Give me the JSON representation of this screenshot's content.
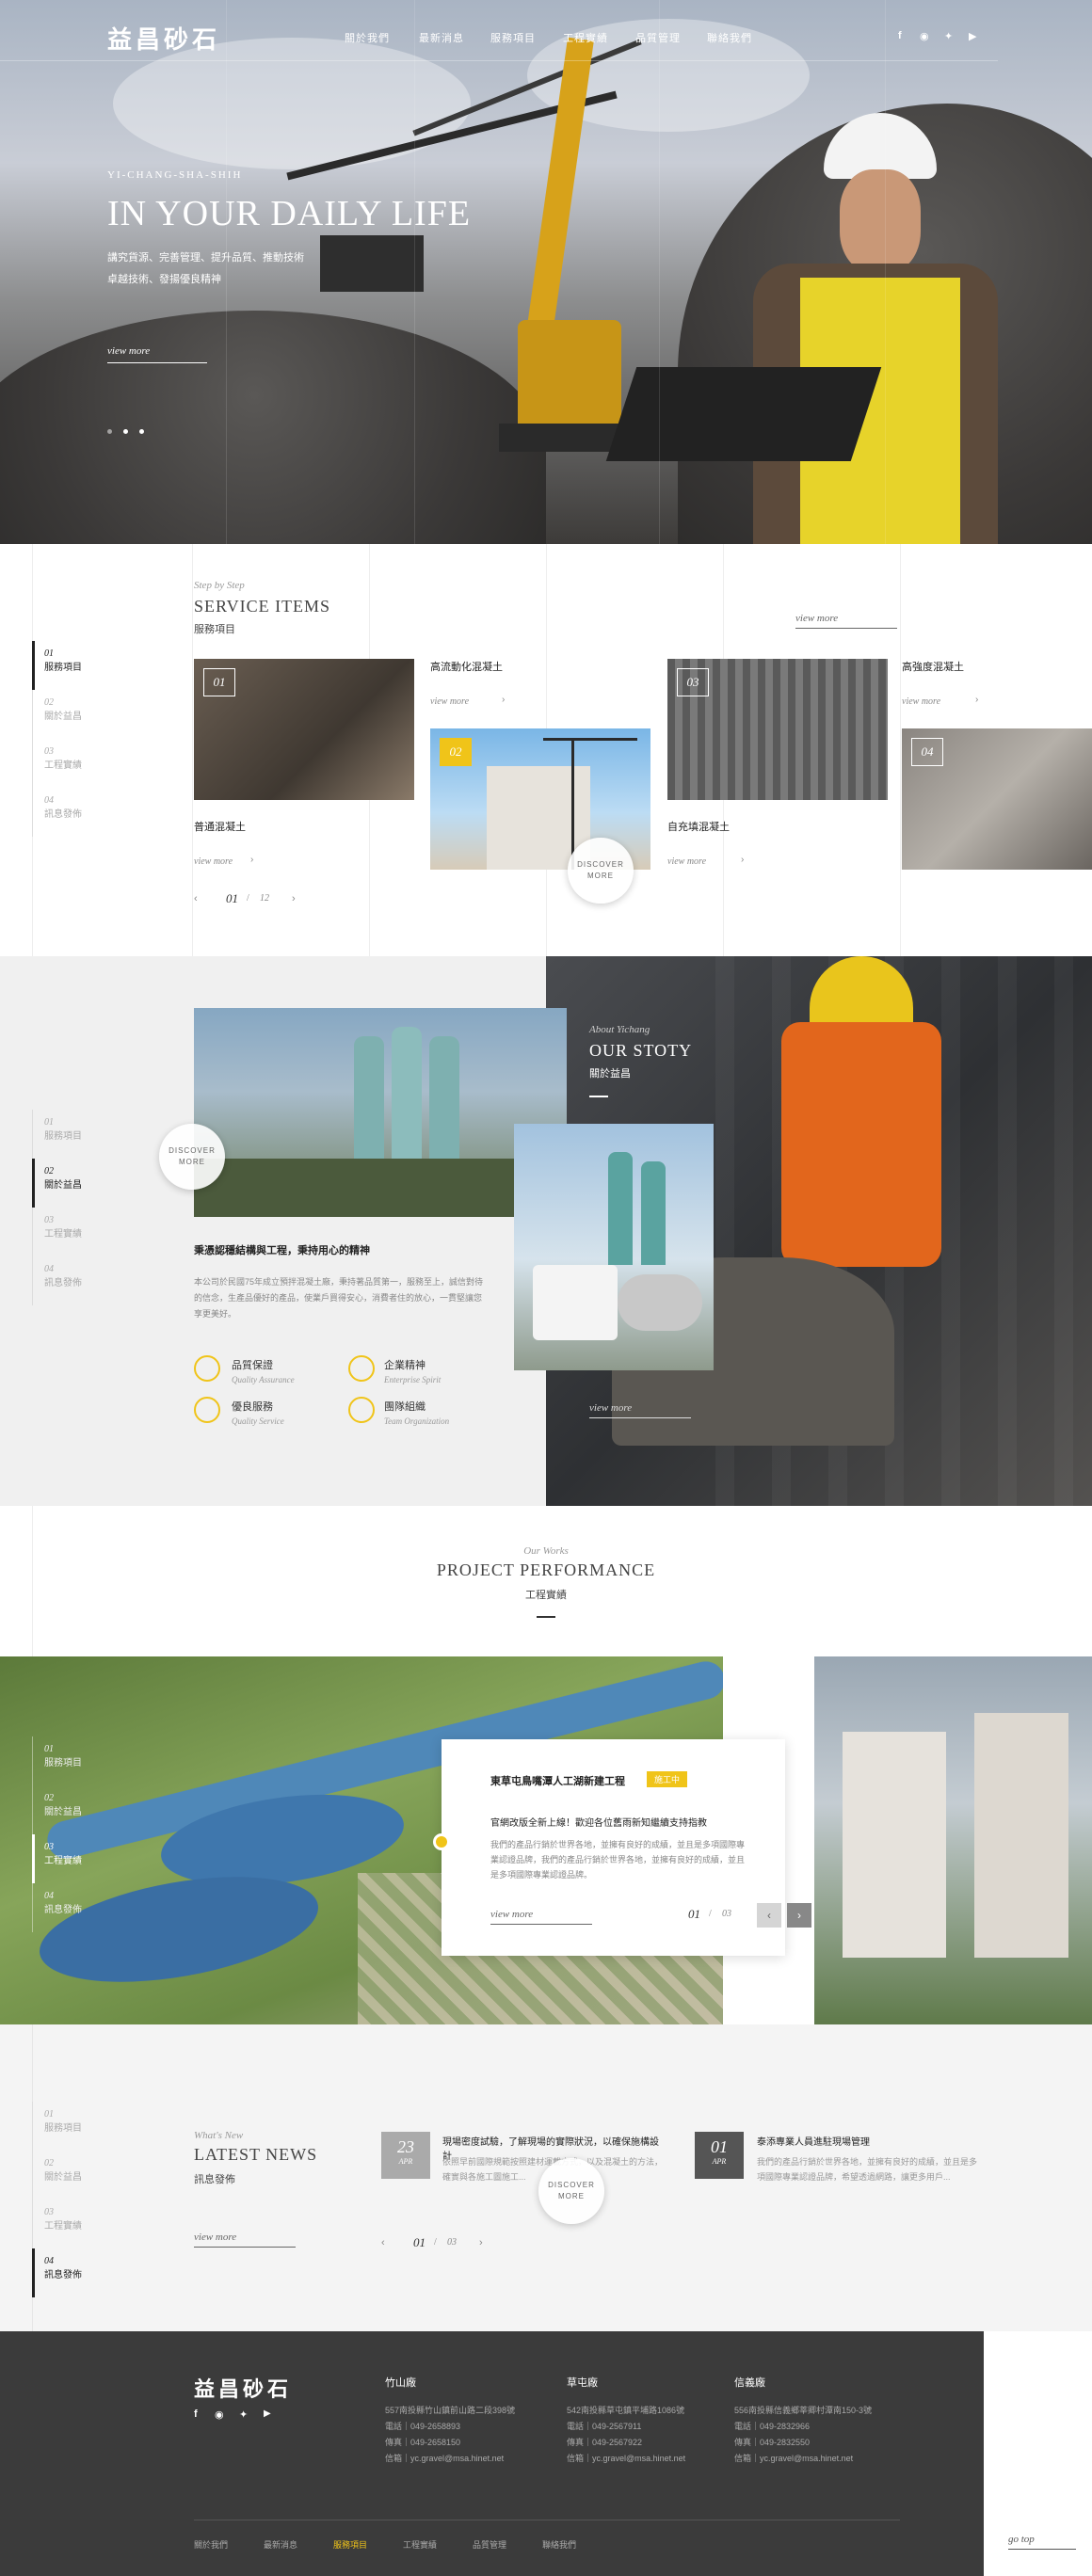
{
  "brand": {
    "logo_text": "益昌砂石"
  },
  "nav": [
    "關於我們",
    "最新消息",
    "服務項目",
    "工程實績",
    "品質管理",
    "聯絡我們"
  ],
  "social_icons": [
    "facebook-icon",
    "line-icon",
    "twitter-icon",
    "youtube-icon"
  ],
  "hero": {
    "eyebrow": "YI-CHANG-SHA-SHIH",
    "title": "IN YOUR DAILY LIFE",
    "line1": "講究貨源、完善管理、提升品質、推動技術",
    "line2": "卓越技術、發揚優良精神",
    "view_more": "view more",
    "dots": 3
  },
  "sidenav_service": [
    {
      "num": "01",
      "label": "服務項目"
    },
    {
      "num": "02",
      "label": "關於益昌"
    },
    {
      "num": "03",
      "label": "工程實績"
    },
    {
      "num": "04",
      "label": "訊息發佈"
    }
  ],
  "service": {
    "sub": "Step by Step",
    "title": "SERVICE ITEMS",
    "cn": "服務項目",
    "view_more": "view more",
    "items": [
      {
        "num": "01",
        "title": "普通混凝土",
        "more": "view more"
      },
      {
        "num": "02",
        "title": "高流動化混凝土",
        "more": "view more"
      },
      {
        "num": "03",
        "title": "自充填混凝土",
        "more": "view more"
      },
      {
        "num": "04",
        "title": "高強度混凝土",
        "more": "view more"
      }
    ],
    "discover": "DISCOVER MORE",
    "pager_current": "01",
    "pager_total": "12"
  },
  "about": {
    "sub": "About Yichang",
    "title": "OUR STOTY",
    "cn": "關於益昌",
    "heading": "秉憑認穩結構與工程，秉持用心的精神",
    "body": "本公司於民國75年成立預拌混凝土廠，秉持著品質第一，服務至上，誠信對待的信念，生產品優好的產品，使業戶買得安心，消費者住的放心，一貫堅讓您享更美好。",
    "view_more": "view more",
    "discover": "DISCOVER MORE",
    "features": [
      {
        "cn": "品質保證",
        "en": "Quality Assurance"
      },
      {
        "cn": "企業精神",
        "en": "Enterprise Spirit"
      },
      {
        "cn": "優良服務",
        "en": "Quality Service"
      },
      {
        "cn": "團隊組織",
        "en": "Team Organization"
      }
    ]
  },
  "sidenav_about": [
    {
      "num": "01",
      "label": "服務項目"
    },
    {
      "num": "02",
      "label": "關於益昌"
    },
    {
      "num": "03",
      "label": "工程實績"
    },
    {
      "num": "04",
      "label": "訊息發佈"
    }
  ],
  "project": {
    "sub": "Our Works",
    "title": "PROJECT PERFORMANCE",
    "cn": "工程實績",
    "card_title": "東草屯鳥嘴潭人工湖新建工程",
    "badge": "施工中",
    "card_heading": "官網改版全新上線！歡迎各位舊雨新知繼續支持指教",
    "card_body": "我們的產品行銷於世界各地，並擁有良好的成績，並且是多項國際專業認證品牌，我們的產品行銷於世界各地，並擁有良好的成績，並且是多項國際專業認證品牌。",
    "view_more": "view more",
    "pager_current": "01",
    "pager_total": "03"
  },
  "sidenav_project": [
    {
      "num": "01",
      "label": "服務項目"
    },
    {
      "num": "02",
      "label": "關於益昌"
    },
    {
      "num": "03",
      "label": "工程實績"
    },
    {
      "num": "04",
      "label": "訊息發佈"
    }
  ],
  "news": {
    "sub": "What's New",
    "title": "LATEST NEWS",
    "cn": "訊息發佈",
    "view_more": "view more",
    "discover": "DISCOVER MORE",
    "pager_current": "01",
    "pager_total": "03",
    "items": [
      {
        "day": "23",
        "month": "APR",
        "title": "現場密度試驗，了解現場的實際狀況，以確保施構設計",
        "body": "依照早前國際規範按照建材運載方式，以及混凝土的方法，確實與各施工圖施工..."
      },
      {
        "day": "01",
        "month": "APR",
        "title": "泰添專業人員進駐現場管理",
        "body": "我們的產品行銷於世界各地，並擁有良好的成績，並且是多項國際專業認證品牌，希望透過網路，讓更多用戶..."
      }
    ]
  },
  "sidenav_news": [
    {
      "num": "01",
      "label": "服務項目"
    },
    {
      "num": "02",
      "label": "關於益昌"
    },
    {
      "num": "03",
      "label": "工程實績"
    },
    {
      "num": "04",
      "label": "訊息發佈"
    }
  ],
  "footer": {
    "logo_text": "益昌砂石",
    "columns": [
      {
        "title": "竹山廠",
        "lines": [
          "557南投縣竹山鎮前山路二段398號",
          "電話｜049-2658893",
          "傳真｜049-2658150",
          "信箱｜yc.gravel@msa.hinet.net"
        ]
      },
      {
        "title": "草屯廠",
        "lines": [
          "542南投縣草屯鎮平埔路1086號",
          "電話｜049-2567911",
          "傳真｜049-2567922",
          "信箱｜yc.gravel@msa.hinet.net"
        ]
      },
      {
        "title": "信義廠",
        "lines": [
          "556南投縣信義鄉莘卿村潭南150-3號",
          "電話｜049-2832966",
          "傳真｜049-2832550",
          "信箱｜yc.gravel@msa.hinet.net"
        ]
      }
    ],
    "nav": [
      "關於我們",
      "最新消息",
      "服務項目",
      "工程實績",
      "品質管理",
      "聯絡我們"
    ],
    "go_top": "go top"
  },
  "colors": {
    "accent": "#f0c419",
    "dark": "#3b3b3b"
  }
}
